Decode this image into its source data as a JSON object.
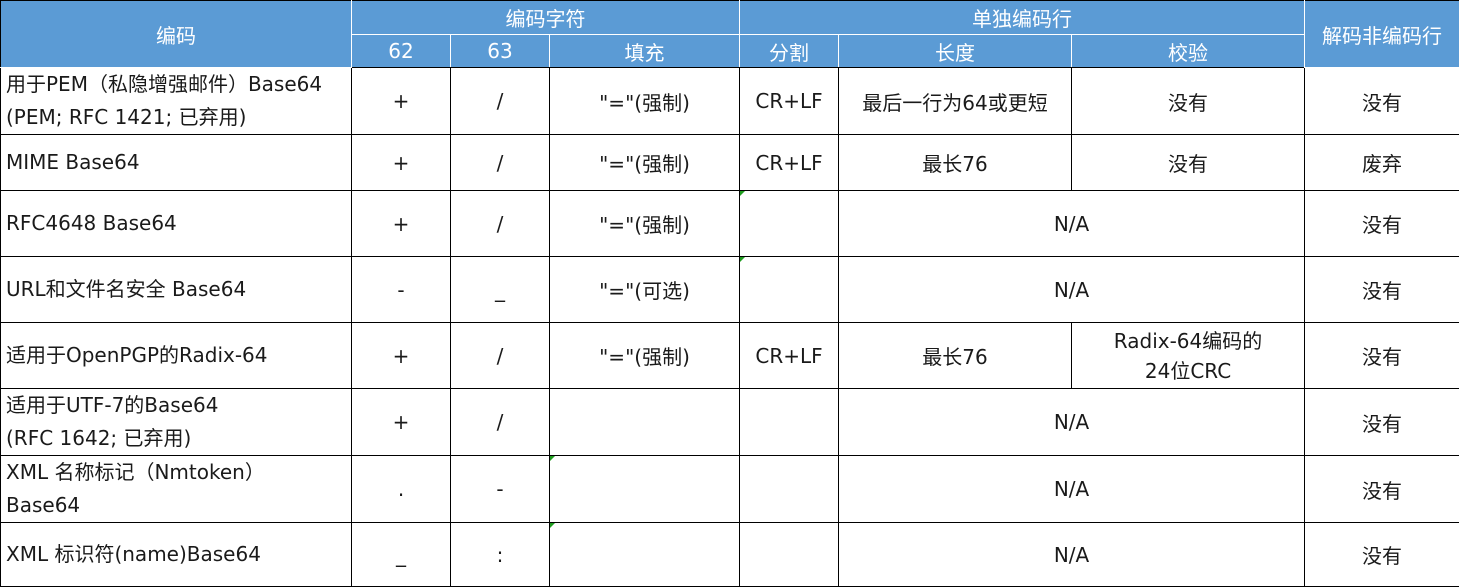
{
  "header": {
    "encoding": "编码",
    "charset_group": "编码字符",
    "col62": "62",
    "col63": "63",
    "padding": "填充",
    "line_group": "单独编码行",
    "separator": "分割",
    "length": "长度",
    "checksum": "校验",
    "decode_non_encoded": "解码非编码行"
  },
  "rows": [
    {
      "name": [
        "用于PEM（私隐增强邮件）Base64",
        "(PEM; RFC 1421; 已弃用)"
      ],
      "c62": "+",
      "c63": "/",
      "pad": "\"=\"(强制)",
      "sep": "CR+LF",
      "len": "最后一行为64或更短",
      "chk": "没有",
      "dec": "没有"
    },
    {
      "name": [
        "MIME Base64"
      ],
      "c62": "+",
      "c63": "/",
      "pad": "\"=\"(强制)",
      "sep": "CR+LF",
      "len": "最长76",
      "chk": "没有",
      "dec": "废弃"
    },
    {
      "name": [
        "RFC4648 Base64"
      ],
      "c62": "+",
      "c63": "/",
      "pad": "\"=\"(强制)",
      "sep": "",
      "na": "N/A",
      "dec": "没有"
    },
    {
      "name": [
        "URL和文件名安全 Base64"
      ],
      "c62": "-",
      "c63": "_",
      "pad": "\"=\"(可选)",
      "sep": "",
      "na": "N/A",
      "dec": "没有"
    },
    {
      "name": [
        "适用于OpenPGP的Radix-64"
      ],
      "c62": "+",
      "c63": "/",
      "pad": "\"=\"(强制)",
      "sep": "CR+LF",
      "len": "最长76",
      "chk": [
        "Radix-64编码的",
        "24位CRC"
      ],
      "dec": "没有"
    },
    {
      "name": [
        "适用于UTF-7的Base64",
        "(RFC 1642; 已弃用)"
      ],
      "c62": "+",
      "c63": "/",
      "pad": "",
      "na": "N/A",
      "dec": "没有"
    },
    {
      "name": [
        "XML 名称标记（Nmtoken）",
        "Base64"
      ],
      "c62": ".",
      "c63": "-",
      "pad": "",
      "na": "N/A",
      "dec": "没有"
    },
    {
      "name": [
        "XML 标识符(name)Base64"
      ],
      "c62": "_",
      "c63": ":",
      "pad": "",
      "na": "N/A",
      "dec": "没有"
    }
  ]
}
